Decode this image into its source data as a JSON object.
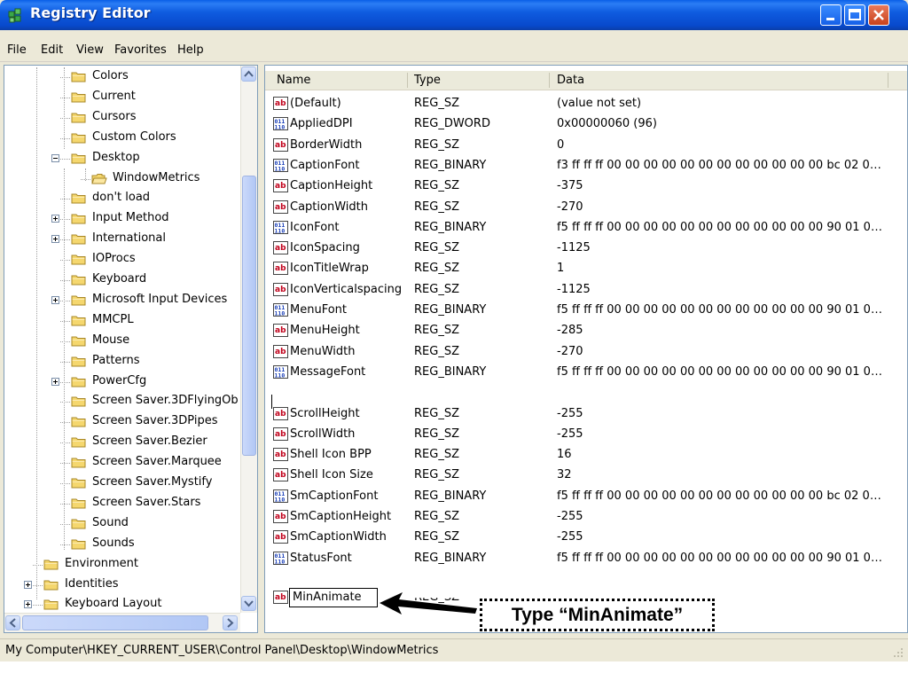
{
  "window": {
    "title": "Registry Editor"
  },
  "menu": [
    "File",
    "Edit",
    "View",
    "Favorites",
    "Help"
  ],
  "tree": {
    "items": [
      {
        "label": "Colors",
        "expander": "none"
      },
      {
        "label": "Current",
        "expander": "none"
      },
      {
        "label": "Cursors",
        "expander": "none"
      },
      {
        "label": "Custom Colors",
        "expander": "none"
      },
      {
        "label": "Desktop",
        "expander": "minus"
      },
      {
        "label": "WindowMetrics",
        "expander": "none",
        "open": true
      },
      {
        "label": "don't load",
        "expander": "none"
      },
      {
        "label": "Input Method",
        "expander": "plus"
      },
      {
        "label": "International",
        "expander": "plus"
      },
      {
        "label": "IOProcs",
        "expander": "none"
      },
      {
        "label": "Keyboard",
        "expander": "none"
      },
      {
        "label": "Microsoft Input Devices",
        "expander": "plus"
      },
      {
        "label": "MMCPL",
        "expander": "none"
      },
      {
        "label": "Mouse",
        "expander": "none"
      },
      {
        "label": "Patterns",
        "expander": "none"
      },
      {
        "label": "PowerCfg",
        "expander": "plus"
      },
      {
        "label": "Screen Saver.3DFlyingOb",
        "expander": "none"
      },
      {
        "label": "Screen Saver.3DPipes",
        "expander": "none"
      },
      {
        "label": "Screen Saver.Bezier",
        "expander": "none"
      },
      {
        "label": "Screen Saver.Marquee",
        "expander": "none"
      },
      {
        "label": "Screen Saver.Mystify",
        "expander": "none"
      },
      {
        "label": "Screen Saver.Stars",
        "expander": "none"
      },
      {
        "label": "Sound",
        "expander": "none"
      },
      {
        "label": "Sounds",
        "expander": "none"
      },
      {
        "label": "Environment",
        "expander": "none"
      },
      {
        "label": "Identities",
        "expander": "plus"
      },
      {
        "label": "Keyboard Layout",
        "expander": "plus"
      }
    ]
  },
  "list": {
    "columns": [
      "Name",
      "Type",
      "Data"
    ],
    "rows": [
      {
        "icon": "string-value-icon",
        "name": "(Default)",
        "type": "REG_SZ",
        "data": "(value not set)"
      },
      {
        "icon": "binary-value-icon",
        "name": "AppliedDPI",
        "type": "REG_DWORD",
        "data": "0x00000060 (96)"
      },
      {
        "icon": "string-value-icon",
        "name": "BorderWidth",
        "type": "REG_SZ",
        "data": "0"
      },
      {
        "icon": "binary-value-icon",
        "name": "CaptionFont",
        "type": "REG_BINARY",
        "data": "f3 ff ff ff 00 00 00 00 00 00 00 00 00 00 00 00 bc 02 0…"
      },
      {
        "icon": "string-value-icon",
        "name": "CaptionHeight",
        "type": "REG_SZ",
        "data": "-375"
      },
      {
        "icon": "string-value-icon",
        "name": "CaptionWidth",
        "type": "REG_SZ",
        "data": "-270"
      },
      {
        "icon": "binary-value-icon",
        "name": "IconFont",
        "type": "REG_BINARY",
        "data": "f5 ff ff ff 00 00 00 00 00 00 00 00 00 00 00 00 90 01 0…"
      },
      {
        "icon": "string-value-icon",
        "name": "IconSpacing",
        "type": "REG_SZ",
        "data": "-1125"
      },
      {
        "icon": "string-value-icon",
        "name": "IconTitleWrap",
        "type": "REG_SZ",
        "data": "1"
      },
      {
        "icon": "string-value-icon",
        "name": "IconVerticalspacing",
        "type": "REG_SZ",
        "data": "-1125"
      },
      {
        "icon": "binary-value-icon",
        "name": "MenuFont",
        "type": "REG_BINARY",
        "data": "f5 ff ff ff 00 00 00 00 00 00 00 00 00 00 00 00 90 01 0…"
      },
      {
        "icon": "string-value-icon",
        "name": "MenuHeight",
        "type": "REG_SZ",
        "data": "-285"
      },
      {
        "icon": "string-value-icon",
        "name": "MenuWidth",
        "type": "REG_SZ",
        "data": "-270"
      },
      {
        "icon": "binary-value-icon",
        "name": "MessageFont",
        "type": "REG_BINARY",
        "data": "f5 ff ff ff 00 00 00 00 00 00 00 00 00 00 00 00 90 01 0…"
      },
      {
        "icon": "string-value-icon",
        "name": "ScrollHeight",
        "type": "REG_SZ",
        "data": "-255"
      },
      {
        "icon": "string-value-icon",
        "name": "ScrollWidth",
        "type": "REG_SZ",
        "data": "-255"
      },
      {
        "icon": "string-value-icon",
        "name": "Shell Icon BPP",
        "type": "REG_SZ",
        "data": "16"
      },
      {
        "icon": "string-value-icon",
        "name": "Shell Icon Size",
        "type": "REG_SZ",
        "data": "32"
      },
      {
        "icon": "binary-value-icon",
        "name": "SmCaptionFont",
        "type": "REG_BINARY",
        "data": "f5 ff ff ff 00 00 00 00 00 00 00 00 00 00 00 00 bc 02 0…"
      },
      {
        "icon": "string-value-icon",
        "name": "SmCaptionHeight",
        "type": "REG_SZ",
        "data": "-255"
      },
      {
        "icon": "string-value-icon",
        "name": "SmCaptionWidth",
        "type": "REG_SZ",
        "data": "-255"
      },
      {
        "icon": "binary-value-icon",
        "name": "StatusFont",
        "type": "REG_BINARY",
        "data": "f5 ff ff ff 00 00 00 00 00 00 00 00 00 00 00 00 90 01 0…"
      }
    ],
    "editing": {
      "icon": "string-value-icon",
      "value": "MinAnimate",
      "type": "REG_SZ"
    }
  },
  "status": {
    "path": "My Computer\\HKEY_CURRENT_USER\\Control Panel\\Desktop\\WindowMetrics"
  },
  "callout": {
    "text": "Type “MinAnimate”"
  },
  "colors": {
    "titlebar": "#0a5fe6",
    "folder": "#f5d76e",
    "selection": "#316ac5"
  }
}
